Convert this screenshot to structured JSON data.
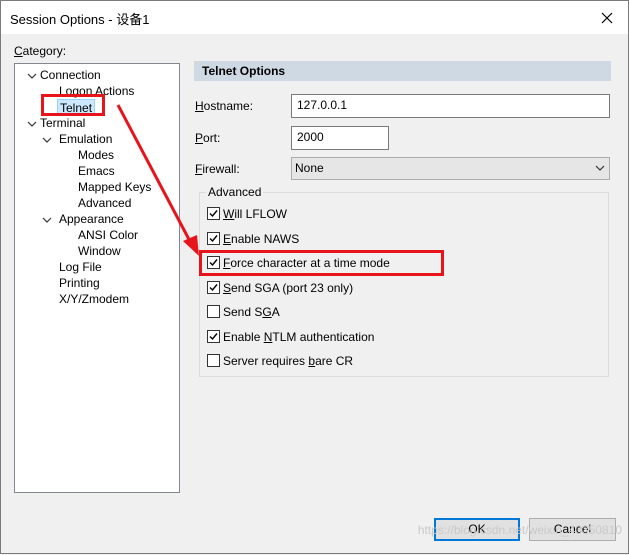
{
  "window": {
    "title": "Session Options - 设备1",
    "category_label": "Category:",
    "category_mnemonic": "C",
    "category_rest": "ategory:"
  },
  "tree": [
    {
      "label": "Connection",
      "level": 0,
      "expanded": true
    },
    {
      "label": "Logon Actions",
      "level": 1
    },
    {
      "label": "Telnet",
      "level": 1,
      "selected": true
    },
    {
      "label": "Terminal",
      "level": 0,
      "expanded": true
    },
    {
      "label": "Emulation",
      "level": 1,
      "expanded": true
    },
    {
      "label": "Modes",
      "level": 2
    },
    {
      "label": "Emacs",
      "level": 2
    },
    {
      "label": "Mapped Keys",
      "level": 2
    },
    {
      "label": "Advanced",
      "level": 2
    },
    {
      "label": "Appearance",
      "level": 1,
      "expanded": true
    },
    {
      "label": "ANSI Color",
      "level": 2
    },
    {
      "label": "Window",
      "level": 2
    },
    {
      "label": "Log File",
      "level": 1
    },
    {
      "label": "Printing",
      "level": 1
    },
    {
      "label": "X/Y/Zmodem",
      "level": 1
    }
  ],
  "panel": {
    "title": "Telnet Options",
    "hostname_m": "H",
    "hostname_rest": "ostname:",
    "hostname_value": "127.0.0.1",
    "port_m": "P",
    "port_rest": "ort:",
    "port_value": "2000",
    "firewall_m": "F",
    "firewall_rest": "irewall:",
    "firewall_value": "None",
    "advanced_label": "Advanced"
  },
  "options": [
    {
      "pre": "",
      "m": "W",
      "post": "ill LFLOW",
      "checked": true
    },
    {
      "pre": "",
      "m": "E",
      "post": "nable NAWS",
      "checked": true
    },
    {
      "pre": "",
      "m": "F",
      "post": "orce character at a time mode",
      "checked": true
    },
    {
      "pre": "",
      "m": "S",
      "post": "end SGA (port 23 only)",
      "checked": true
    },
    {
      "pre": "Send S",
      "m": "G",
      "post": "A",
      "checked": false
    },
    {
      "pre": "Enable ",
      "m": "N",
      "post": "TLM authentication",
      "checked": true
    },
    {
      "pre": "Server requires ",
      "m": "b",
      "post": "are CR",
      "checked": false
    }
  ],
  "buttons": {
    "ok": "OK",
    "cancel": "Cancel"
  },
  "watermark": "https://blog.csdn.net/weixin_43350810",
  "colors": {
    "highlight": "#e8141b",
    "selection": "#cce8ff",
    "header": "#cfd9e4"
  }
}
